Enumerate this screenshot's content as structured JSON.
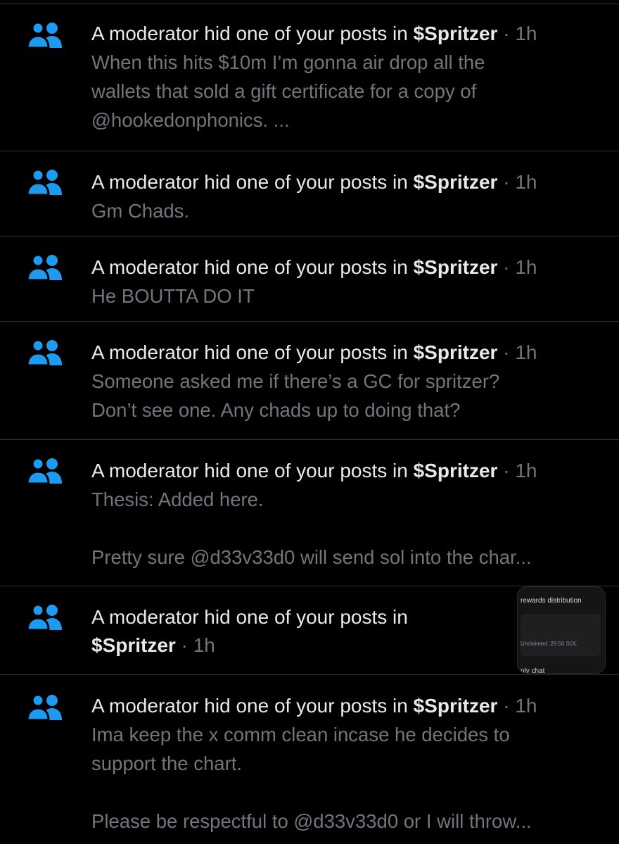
{
  "colors": {
    "background": "#000000",
    "divider": "#2f3336",
    "primary_text": "#e7e9ea",
    "secondary_text": "#71767b",
    "icon_blue": "#1d9bf0"
  },
  "notifications": [
    {
      "icon": "community-icon",
      "action": "A moderator hid one of your posts in",
      "community": "$Spritzer",
      "separator": "·",
      "time": "1h",
      "body": "When this hits $10m I’m gonna air drop all the\nwallets that sold a gift certificate for a copy of\n@hookedonphonics. ..."
    },
    {
      "icon": "community-icon",
      "action": "A moderator hid one of your posts in",
      "community": "$Spritzer",
      "separator": "·",
      "time": "1h",
      "body": "Gm Chads."
    },
    {
      "icon": "community-icon",
      "action": "A moderator hid one of your posts in",
      "community": "$Spritzer",
      "separator": "·",
      "time": "1h",
      "body": "He BOUTTA DO IT"
    },
    {
      "icon": "community-icon",
      "action": "A moderator hid one of your posts in",
      "community": "$Spritzer",
      "separator": "·",
      "time": "1h",
      "body": "Someone asked me if there’s a GC for spritzer?\nDon’t see one. Any chads up to doing that?"
    },
    {
      "icon": "community-icon",
      "action": "A moderator hid one of your posts in",
      "community": "$Spritzer",
      "separator": "·",
      "time": "1h",
      "body": "Thesis: Added here.\n\nPretty sure @d33v33d0 will send sol into the char..."
    },
    {
      "icon": "community-icon",
      "action": "A moderator hid one of your posts in",
      "community": "$Spritzer",
      "separator": "·",
      "time": "1h",
      "body": "",
      "thumbnail": {
        "title": "rewards distribution",
        "unclaimed": "Unclaimed: 28.56 SOL",
        "footer": "ply chat"
      }
    },
    {
      "icon": "community-icon",
      "action": "A moderator hid one of your posts in",
      "community": "$Spritzer",
      "separator": "·",
      "time": "1h",
      "body": "Ima keep the x comm clean incase he decides to\nsupport the chart.\n\nPlease be respectful to @d33v33d0 or I will throw..."
    }
  ]
}
